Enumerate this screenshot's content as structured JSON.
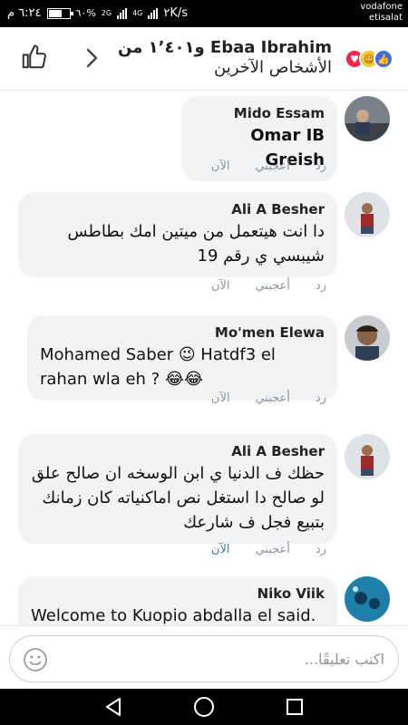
{
  "status": {
    "time": "٦:٢٤ م",
    "battery": "٦٠%",
    "network_types": [
      "2G",
      "4G"
    ],
    "speed": "٢K/s",
    "carrier_1": "vodafone",
    "carrier_2": "etisalat"
  },
  "header": {
    "line1": "Ebaa Ibrahim و١٬٤٠١ من",
    "line2": "الأشخاص الآخرين",
    "reactions": [
      "heart",
      "haha",
      "like"
    ],
    "colors": {
      "heart": "#f0284a",
      "haha": "#f7c531",
      "like": "#3b6fe0"
    }
  },
  "comments": [
    {
      "author": "Mido Essam",
      "text": "Omar IB Greish",
      "text_style": "bold",
      "actions": {
        "reply": "رد",
        "like": "أعجبني",
        "time": "الآن"
      },
      "avatar": "avatar-photo"
    },
    {
      "author": "Ali A Besher",
      "text": "دا انت هيتعمل من ميتين امك بطاطس شيبسي ي رقم 19",
      "actions": {
        "reply": "رد",
        "like": "أعجبني",
        "time": "الآن"
      },
      "avatar": "avatar-photo"
    },
    {
      "author": "Mo'men Elewa",
      "text": "Mohamed Saber 😉 Hatdf3 el rahan wla eh ? 😂😂",
      "actions": {
        "reply": "رد",
        "like": "أعجبني",
        "time": "الآن"
      },
      "avatar": "avatar-photo"
    },
    {
      "author": "Ali A Besher",
      "text": "حظك ف الدنيا ي ابن الوسخه ان صالح علق لو صالح دا استغل نص اماكنياته كان زمانك بتبيع فجل ف شارعك",
      "actions": {
        "reply": "رد",
        "like": "أعجبني",
        "time": "الآن"
      },
      "time_highlight": true,
      "avatar": "avatar-photo"
    },
    {
      "author": "Niko Viik",
      "text": "Welcome to Kuopio abdalla el said.",
      "avatar": "avatar-photo"
    }
  ],
  "input": {
    "placeholder": "اكتب تعليقًا..."
  },
  "accent": "#4a76a8"
}
